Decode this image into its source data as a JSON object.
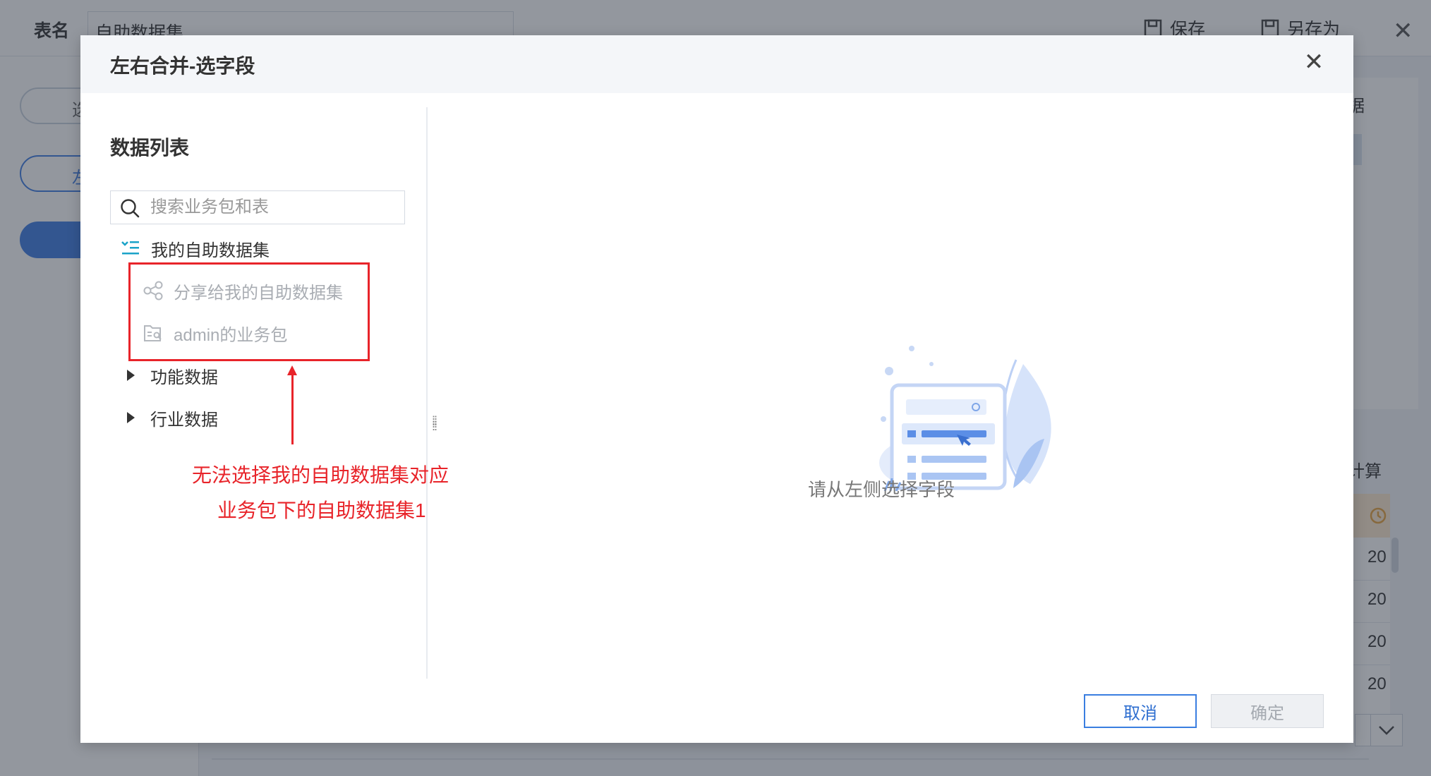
{
  "background": {
    "table_name_label": "表名",
    "table_name_value": "自助数据集",
    "save_label": "保存",
    "save_as_label": "另存为",
    "side_pills": [
      "选",
      "左"
    ],
    "right_texts": [
      "据",
      "计算"
    ],
    "right_cells": [
      "20",
      "20",
      "20",
      "20"
    ]
  },
  "dialog": {
    "title": "左右合并-选字段",
    "left": {
      "section_title": "数据列表",
      "search_placeholder": "搜索业务包和表",
      "tree": [
        {
          "label": "我的自助数据集",
          "icon": "self-dataset-icon",
          "disabled": false
        },
        {
          "label": "分享给我的自助数据集",
          "icon": "share-icon",
          "disabled": true
        },
        {
          "label": "admin的业务包",
          "icon": "business-package-icon",
          "disabled": true
        },
        {
          "label": "功能数据",
          "icon": "caret-right-icon",
          "disabled": false
        },
        {
          "label": "行业数据",
          "icon": "caret-right-icon",
          "disabled": false
        }
      ]
    },
    "annotation": {
      "line1": "无法选择我的自助数据集对应",
      "line2": "业务包下的自助数据集1",
      "color": "#e8242a"
    },
    "empty_state_text": "请从左侧选择字段",
    "cancel_label": "取消",
    "confirm_label": "确定"
  },
  "colors": {
    "accent": "#3a7ee0",
    "annotation": "#e8242a",
    "disabled_text": "#a9adb3"
  }
}
